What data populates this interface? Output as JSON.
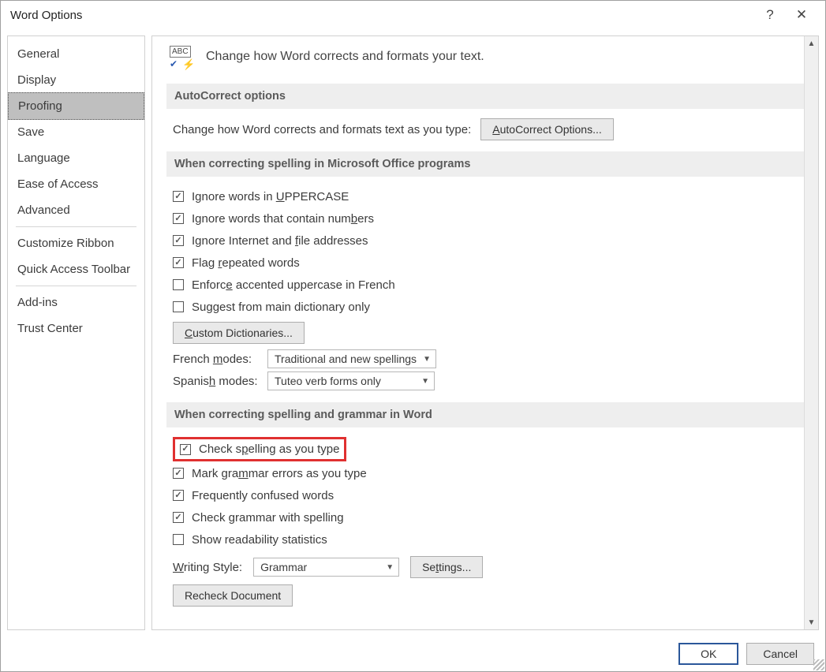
{
  "title": "Word Options",
  "sidebar": {
    "items": [
      {
        "label": "General"
      },
      {
        "label": "Display"
      },
      {
        "label": "Proofing",
        "selected": true
      },
      {
        "label": "Save"
      },
      {
        "label": "Language"
      },
      {
        "label": "Ease of Access"
      },
      {
        "label": "Advanced"
      },
      {
        "sep": true
      },
      {
        "label": "Customize Ribbon"
      },
      {
        "label": "Quick Access Toolbar"
      },
      {
        "sep": true
      },
      {
        "label": "Add-ins"
      },
      {
        "label": "Trust Center"
      }
    ]
  },
  "header_text": "Change how Word corrects and formats your text.",
  "sec1": {
    "title": "AutoCorrect options",
    "text": "Change how Word corrects and formats text as you type:",
    "button": "AutoCorrect Options..."
  },
  "sec2": {
    "title": "When correcting spelling in Microsoft Office programs",
    "c1": "Ignore words in UPPERCASE",
    "c2": "Ignore words that contain numbers",
    "c3": "Ignore Internet and file addresses",
    "c4": "Flag repeated words",
    "c5": "Enforce accented uppercase in French",
    "c6": "Suggest from main dictionary only",
    "btn": "Custom Dictionaries...",
    "french_label": "French modes:",
    "french_value": "Traditional and new spellings",
    "spanish_label": "Spanish modes:",
    "spanish_value": "Tuteo verb forms only"
  },
  "sec3": {
    "title": "When correcting spelling and grammar in Word",
    "c1": "Check spelling as you type",
    "c2": "Mark grammar errors as you type",
    "c3": "Frequently confused words",
    "c4": "Check grammar with spelling",
    "c5": "Show readability statistics",
    "ws_label": "Writing Style:",
    "ws_value": "Grammar",
    "settings_btn": "Settings...",
    "recheck_btn": "Recheck Document"
  },
  "footer": {
    "ok": "OK",
    "cancel": "Cancel"
  }
}
